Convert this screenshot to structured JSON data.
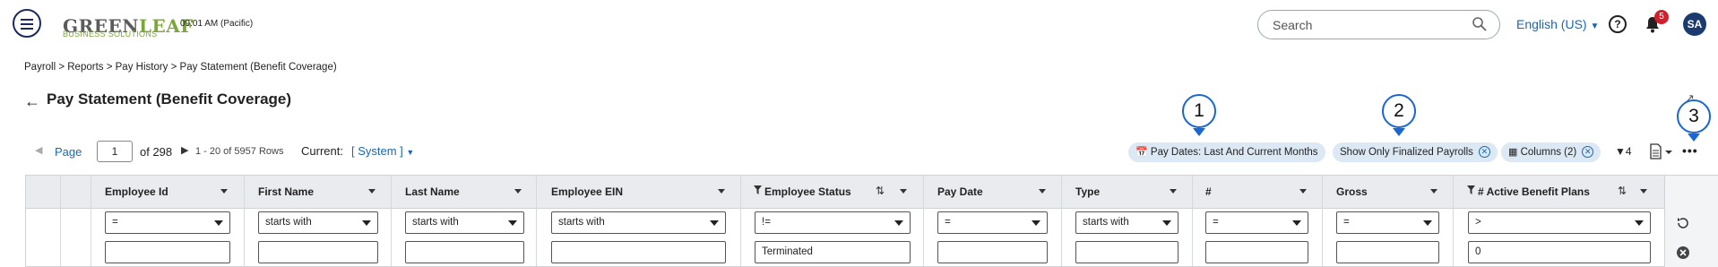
{
  "header": {
    "logo_main_a": "GREEN",
    "logo_main_b": "LEAF",
    "logo_sub": "BUSINESS SOLUTIONS",
    "time": "09:01 AM (Pacific)",
    "search_placeholder": "Search",
    "language": "English (US)",
    "notification_count": "5",
    "avatar_initials": "SA"
  },
  "breadcrumb": "Payroll > Reports > Pay History > Pay Statement (Benefit Coverage)",
  "page_title": "Pay Statement (Benefit Coverage)",
  "callouts": [
    "1",
    "2",
    "3"
  ],
  "pagination": {
    "label": "Page",
    "current_page": "1",
    "of_pages": "of 298",
    "rows_info": "1 - 20 of 5957 Rows",
    "current_label": "Current:",
    "current_value": "[ System ]"
  },
  "chips": {
    "pay_dates": "Pay Dates: Last And Current Months",
    "finalized": "Show Only Finalized Payrolls",
    "columns": "Columns (2)"
  },
  "filter_count": "4",
  "columns": [
    {
      "label": "Employee Id",
      "operator": "=",
      "value": ""
    },
    {
      "label": "First Name",
      "operator": "starts with",
      "value": ""
    },
    {
      "label": "Last Name",
      "operator": "starts with",
      "value": ""
    },
    {
      "label": "Employee EIN",
      "operator": "starts with",
      "value": ""
    },
    {
      "label": "Employee Status",
      "operator": "!=",
      "value": "Terminated"
    },
    {
      "label": "Pay Date",
      "operator": "=",
      "value": ""
    },
    {
      "label": "Type",
      "operator": "starts with",
      "value": ""
    },
    {
      "label": "#",
      "operator": "=",
      "value": ""
    },
    {
      "label": "Gross",
      "operator": "=",
      "value": ""
    },
    {
      "label": "# Active Benefit Plans",
      "operator": ">",
      "value": "0"
    }
  ],
  "colors": {
    "accent": "#1a67b5",
    "callout": "#1a66d2",
    "badge": "#d21f2b",
    "chip_bg": "#dce8f4"
  }
}
